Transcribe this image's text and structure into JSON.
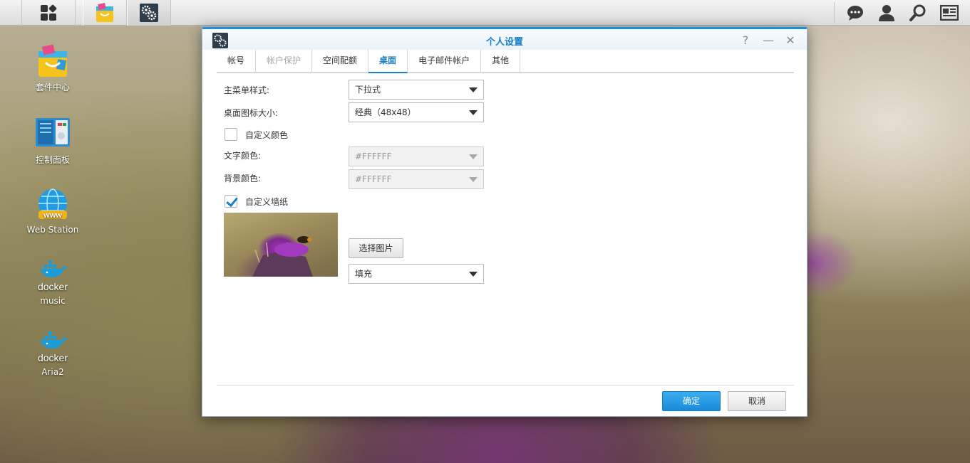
{
  "taskbar": {
    "main_menu_icon": "grid-icon",
    "apps": [
      {
        "icon": "package-center-icon"
      },
      {
        "icon": "control-panel-icon"
      }
    ],
    "right_icons": [
      "chat-icon",
      "user-icon",
      "search-icon",
      "widgets-icon"
    ]
  },
  "desktop": {
    "icons": [
      {
        "label": "套件中心",
        "icon": "package-center-icon"
      },
      {
        "label": "控制面板",
        "icon": "control-panel-icon"
      },
      {
        "label": "Web Station",
        "icon": "web-station-icon"
      },
      {
        "label": "music",
        "sub": "docker",
        "icon": "docker-icon"
      },
      {
        "label": "Aria2",
        "sub": "docker",
        "icon": "docker-icon"
      }
    ]
  },
  "window": {
    "title": "个人设置",
    "controls": {
      "help": "?",
      "minimize": "—",
      "close": "✕"
    },
    "tabs": [
      {
        "label": "帐号",
        "state": "normal"
      },
      {
        "label": "帐户保护",
        "state": "disabled"
      },
      {
        "label": "空间配额",
        "state": "normal"
      },
      {
        "label": "桌面",
        "state": "active"
      },
      {
        "label": "电子邮件帐户",
        "state": "normal"
      },
      {
        "label": "其他",
        "state": "normal"
      }
    ],
    "form": {
      "menu_style_label": "主菜单样式:",
      "menu_style_value": "下拉式",
      "icon_size_label": "桌面图标大小:",
      "icon_size_value": "经典（48x48）",
      "custom_color_label": "自定义颜色",
      "custom_color_checked": false,
      "text_color_label": "文字颜色:",
      "text_color_value": "#FFFFFF",
      "bg_color_label": "背景颜色:",
      "bg_color_value": "#FFFFFF",
      "custom_wallpaper_label": "自定义墙纸",
      "custom_wallpaper_checked": true,
      "choose_image_label": "选择图片",
      "fit_value": "填充"
    },
    "buttons": {
      "ok": "确定",
      "cancel": "取消"
    },
    "colors": {
      "accent": "#1a7fc4",
      "primary_button": "#1a8ad8"
    }
  }
}
